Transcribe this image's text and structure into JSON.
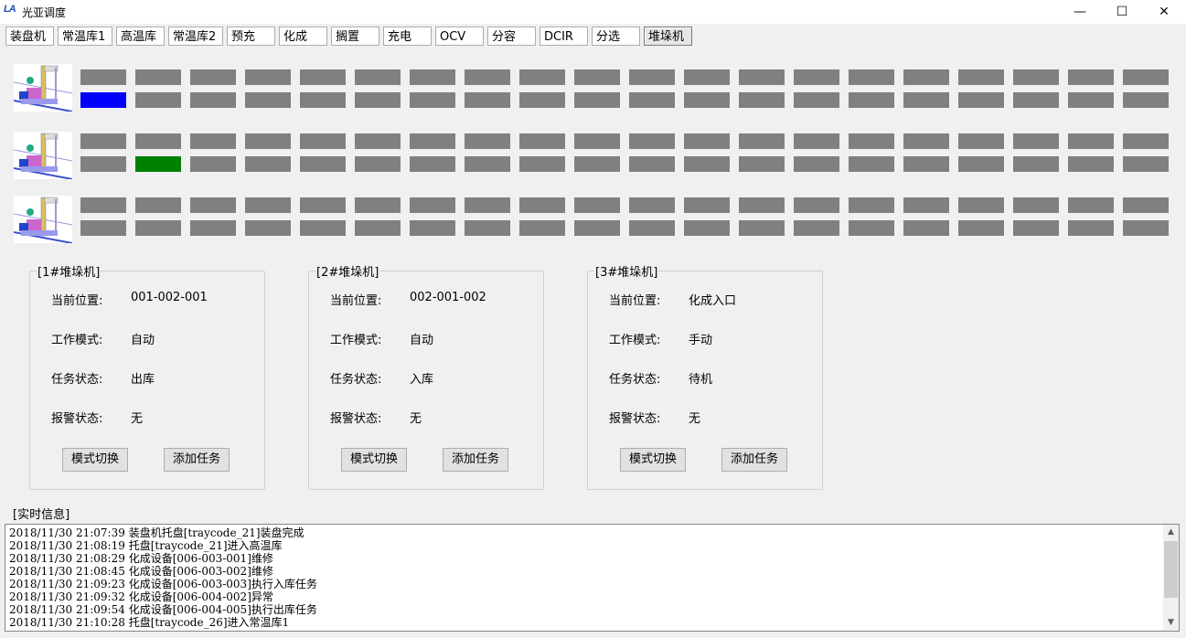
{
  "window": {
    "logo": "LA",
    "title": "光亚调度",
    "min": "—",
    "max": "☐",
    "close": "✕"
  },
  "tabs": [
    "装盘机",
    "常温库1",
    "高温库",
    "常温库2",
    "预充",
    "化成",
    "搁置",
    "充电",
    "OCV",
    "分容",
    "DCIR",
    "分选",
    "堆垛机"
  ],
  "grid": {
    "columns": 20,
    "colors": {
      "empty": "#808080",
      "blue": "#0000ff",
      "green": "#008000"
    },
    "rows": [
      {
        "top": [],
        "bottom": [
          {
            "col": 0,
            "color": "blue"
          }
        ]
      },
      {
        "top": [],
        "bottom": [
          {
            "col": 1,
            "color": "green"
          }
        ]
      },
      {
        "top": [],
        "bottom": []
      }
    ]
  },
  "panels": [
    {
      "title": "[1#堆垛机]",
      "position_label": "当前位置:",
      "position": "001-002-001",
      "mode_label": "工作模式:",
      "mode": "自动",
      "task_label": "任务状态:",
      "task": "出库",
      "alarm_label": "报警状态:",
      "alarm": "无",
      "switch_btn": "模式切换",
      "add_btn": "添加任务"
    },
    {
      "title": "[2#堆垛机]",
      "position_label": "当前位置:",
      "position": "002-001-002",
      "mode_label": "工作模式:",
      "mode": "自动",
      "task_label": "任务状态:",
      "task": "入库",
      "alarm_label": "报警状态:",
      "alarm": "无",
      "switch_btn": "模式切换",
      "add_btn": "添加任务"
    },
    {
      "title": "[3#堆垛机]",
      "position_label": "当前位置:",
      "position": "化成入口",
      "mode_label": "工作模式:",
      "mode": "手动",
      "task_label": "任务状态:",
      "task": "待机",
      "alarm_label": "报警状态:",
      "alarm": "无",
      "switch_btn": "模式切换",
      "add_btn": "添加任务"
    }
  ],
  "log": {
    "label": "[实时信息]",
    "lines": [
      "2018/11/30  21:07:39 装盘机托盘[traycode_21]装盘完成",
      "2018/11/30  21:08:19 托盘[traycode_21]进入高温库",
      "2018/11/30  21:08:29 化成设备[006-003-001]维修",
      "2018/11/30  21:08:45 化成设备[006-003-002]维修",
      "2018/11/30  21:09:23 化成设备[006-003-003]执行入库任务",
      "2018/11/30  21:09:32 化成设备[006-004-002]异常",
      "2018/11/30  21:09:54 化成设备[006-004-005]执行出库任务",
      "2018/11/30  21:10:28 托盘[traycode_26]进入常温库1"
    ]
  },
  "icons": {
    "scroll_up": "▲",
    "scroll_down": "▼"
  }
}
